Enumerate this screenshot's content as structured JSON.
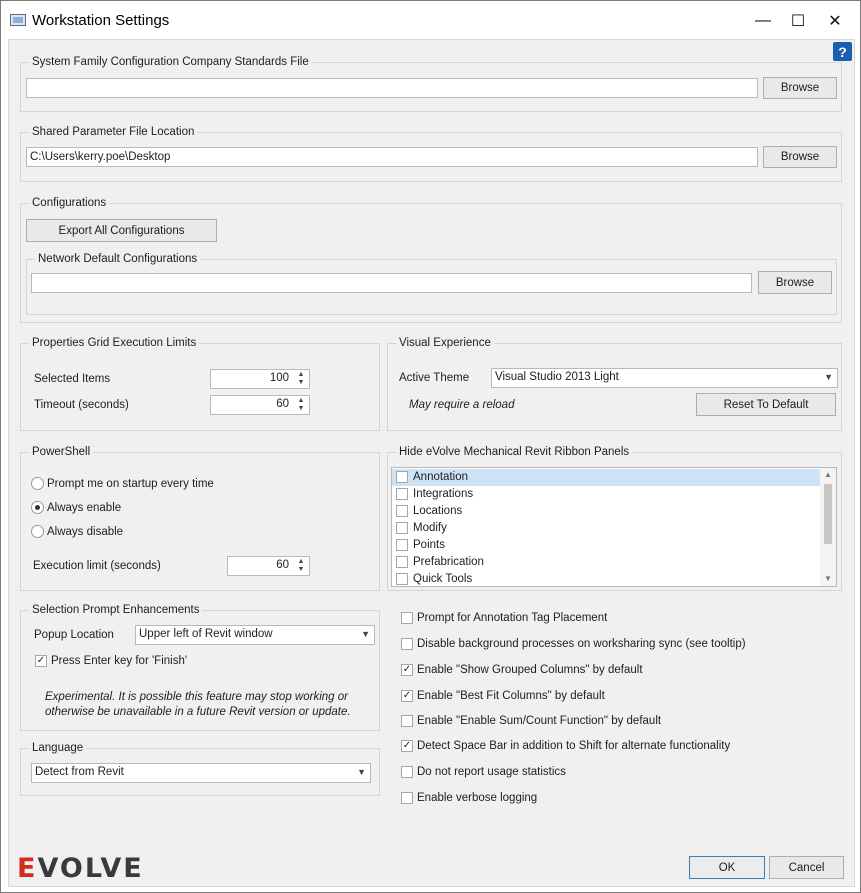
{
  "window": {
    "title": "Workstation Settings",
    "icons": {
      "app": "settings-app-icon",
      "minimize": "minimize-icon",
      "maximize": "maximize-icon",
      "close": "close-icon",
      "help": "help-icon"
    },
    "help_glyph": "?",
    "minimize_glyph": "—",
    "maximize_glyph": "☐",
    "close_glyph": "✕"
  },
  "standards": {
    "title": "System Family Configuration Company Standards File",
    "path_value": "",
    "browse_label": "Browse"
  },
  "shared_param": {
    "title": "Shared Parameter File Location",
    "path_value": "C:\\Users\\kerry.poe\\Desktop",
    "browse_label": "Browse"
  },
  "configurations": {
    "title": "Configurations",
    "export_label": "Export All Configurations",
    "network": {
      "title": "Network Default Configurations",
      "path_value": "",
      "browse_label": "Browse"
    }
  },
  "grid_limits": {
    "title": "Properties Grid Execution Limits",
    "selected_items_label": "Selected Items",
    "selected_items_value": "100",
    "timeout_label": "Timeout (seconds)",
    "timeout_value": "60"
  },
  "visual": {
    "title": "Visual Experience",
    "theme_label": "Active Theme",
    "theme_value": "Visual Studio 2013 Light",
    "reload_note": "May require a reload",
    "reset_label": "Reset To Default"
  },
  "powershell": {
    "title": "PowerShell",
    "options": [
      {
        "label": "Prompt me on startup every time",
        "checked": false
      },
      {
        "label": "Always enable",
        "checked": true
      },
      {
        "label": "Always disable",
        "checked": false
      }
    ],
    "exec_limit_label": "Execution limit (seconds)",
    "exec_limit_value": "60"
  },
  "ribbon": {
    "title": "Hide eVolve Mechanical Revit Ribbon Panels",
    "items": [
      {
        "label": "Annotation",
        "checked": false,
        "selected": true
      },
      {
        "label": "Integrations",
        "checked": false,
        "selected": false
      },
      {
        "label": "Locations",
        "checked": false,
        "selected": false
      },
      {
        "label": "Modify",
        "checked": false,
        "selected": false
      },
      {
        "label": "Points",
        "checked": false,
        "selected": false
      },
      {
        "label": "Prefabrication",
        "checked": false,
        "selected": false
      },
      {
        "label": "Quick Tools",
        "checked": false,
        "selected": false
      }
    ]
  },
  "selection_prompt": {
    "title": "Selection Prompt Enhancements",
    "popup_label": "Popup Location",
    "popup_value": "Upper left of Revit window",
    "enter_label": "Press Enter key for 'Finish'",
    "enter_checked": true,
    "note": "Experimental. It is possible this feature may stop working or otherwise be unavailable in a future Revit version or update."
  },
  "options": [
    {
      "label": "Prompt for Annotation Tag Placement",
      "checked": false
    },
    {
      "label": "Disable background processes on worksharing sync (see tooltip)",
      "checked": false
    },
    {
      "label": "Enable \"Show Grouped Columns\" by default",
      "checked": true
    },
    {
      "label": "Enable \"Best Fit Columns\" by default",
      "checked": true
    },
    {
      "label": "Enable \"Enable Sum/Count Function\" by default",
      "checked": false
    },
    {
      "label": "Detect Space Bar in addition to Shift for alternate functionality",
      "checked": true
    },
    {
      "label": "Do not report usage statistics",
      "checked": false
    },
    {
      "label": "Enable verbose logging",
      "checked": false
    }
  ],
  "language": {
    "title": "Language",
    "value": "Detect from Revit"
  },
  "footer": {
    "logo_e": "E",
    "logo_rest": "VOLVE",
    "ok_label": "OK",
    "cancel_label": "Cancel"
  }
}
